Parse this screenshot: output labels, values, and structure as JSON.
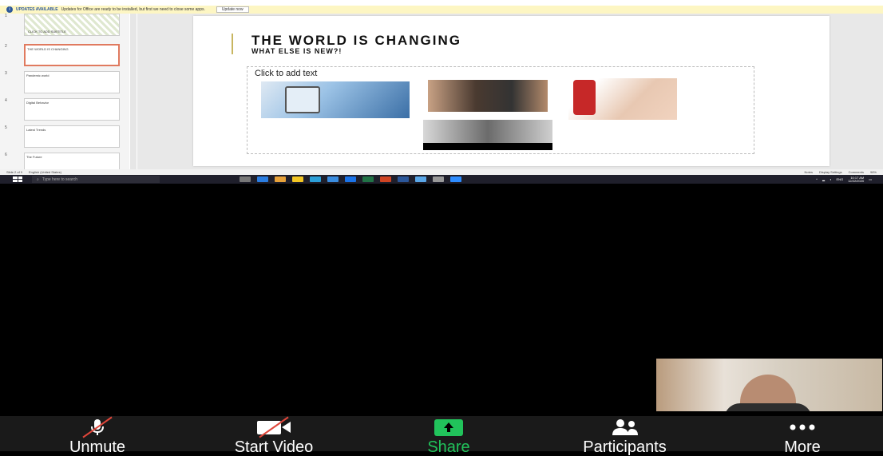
{
  "update_bar": {
    "title": "UPDATES AVAILABLE",
    "message": "Updates for Office are ready to be installed, but first we need to close some apps.",
    "button": "Update now"
  },
  "thumbnails": [
    {
      "num": "1",
      "caption": "CLICK TO ADD SUBTITLE"
    },
    {
      "num": "2",
      "caption": "THE WORLD IS CHANGING"
    },
    {
      "num": "3",
      "caption": "Pandemic world"
    },
    {
      "num": "4",
      "caption": "Digital Behavior"
    },
    {
      "num": "5",
      "caption": "Latest Trends"
    },
    {
      "num": "6",
      "caption": "The Future"
    }
  ],
  "slide": {
    "title": "THE WORLD IS CHANGING",
    "subtitle": "WHAT ELSE IS NEW?!",
    "placeholder": "Click to add text"
  },
  "status_bar": {
    "slide_count": "Slide 2 of 9",
    "language": "English (United States)",
    "notes": "Notes",
    "display_settings": "Display Settings",
    "comments": "Comments",
    "zoom": "98%"
  },
  "taskbar": {
    "search_placeholder": "Type here to search",
    "time": "10:17 AM",
    "date": "12/22/2020",
    "lang": "ENG"
  },
  "toolbar": {
    "unmute": "Unmute",
    "start_video": "Start Video",
    "share": "Share",
    "participants": "Participants",
    "more": "More"
  },
  "colors": {
    "share_green": "#21c35b",
    "slash_red": "#e0463a"
  }
}
